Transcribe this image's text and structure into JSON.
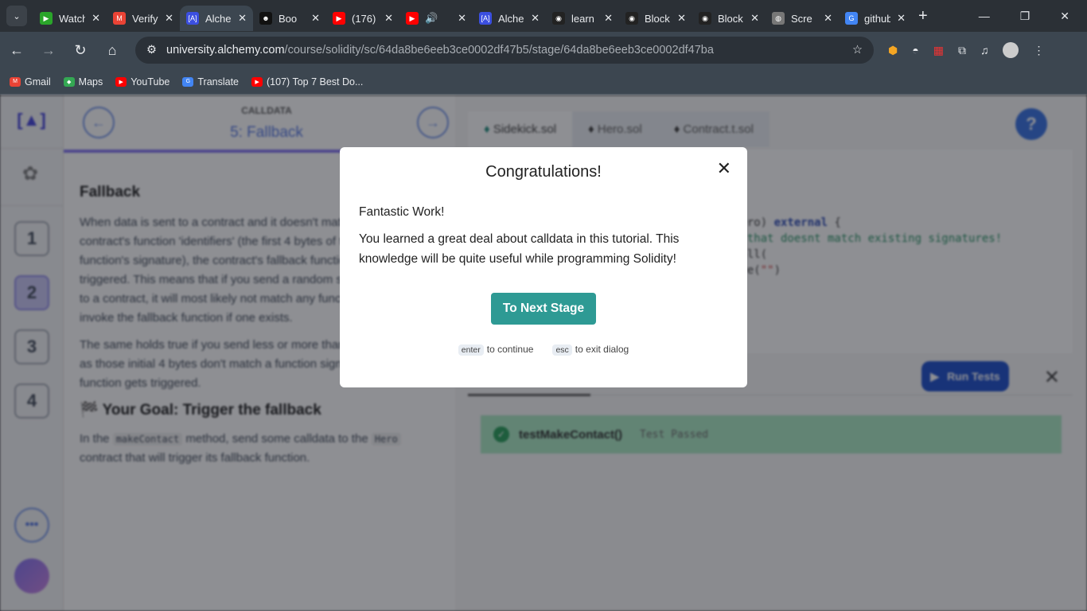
{
  "browser": {
    "tabs": [
      {
        "title": "Watch",
        "fav": "▶",
        "color": "#2aa52a"
      },
      {
        "title": "Verify",
        "fav": "M",
        "color": "#ea4335"
      },
      {
        "title": "Alchemy",
        "fav": "[A]",
        "color": "#3b4fe0",
        "active": true
      },
      {
        "title": "Boo",
        "fav": "☻",
        "color": "#111"
      },
      {
        "title": "(176)",
        "fav": "▶",
        "color": "#f00"
      },
      {
        "title": "🔊",
        "fav": "▶",
        "color": "#f00"
      },
      {
        "title": "Alchemy",
        "fav": "[A]",
        "color": "#3b4fe0"
      },
      {
        "title": "learn",
        "fav": "◉",
        "color": "#222"
      },
      {
        "title": "Block",
        "fav": "◉",
        "color": "#222"
      },
      {
        "title": "Block",
        "fav": "◉",
        "color": "#222"
      },
      {
        "title": "Scre",
        "fav": "◍",
        "color": "#777"
      },
      {
        "title": "github",
        "fav": "G",
        "color": "#4285f4"
      }
    ],
    "url_host": "university.alchemy.com",
    "url_path": "/course/solidity/sc/64da8be6eeb3ce0002df47b5/stage/64da8be6eeb3ce0002df47ba",
    "bookmarks": [
      {
        "label": "Gmail",
        "color": "#ea4335",
        "fav": "M"
      },
      {
        "label": "Maps",
        "color": "#34a853",
        "fav": "◆"
      },
      {
        "label": "YouTube",
        "color": "#f00",
        "fav": "▶"
      },
      {
        "label": "Translate",
        "color": "#4285f4",
        "fav": "G"
      },
      {
        "label": "(107) Top 7 Best Do...",
        "color": "#f00",
        "fav": "▶"
      }
    ]
  },
  "lesson": {
    "kicker": "CALLDATA",
    "stage_title": "5: Fallback",
    "stages": [
      "1",
      "2",
      "3",
      "4"
    ],
    "more": "•••",
    "heading": "Fallback",
    "para1": "When data is sent to a contract and it doesn't match any of the contract's function 'identifiers' (the first 4 bytes of the hash of the function's signature), the contract's fallback function will be triggered. This means that if you send a random sequence of bytes to a contract, it will most likely not match any function and will invoke the fallback function if one exists.",
    "para2": "The same holds true if you send less or more than 4 bytes. As long as those initial 4 bytes don't match a function signature, the fallback function gets triggered.",
    "goal": "🏁 Your Goal: Trigger the fallback",
    "goal_a": "In the ",
    "goal_code1": "makeContact",
    "goal_b": " method, send some calldata to the ",
    "goal_code2": "Hero",
    "goal_c": " contract that will trigger its fallback function."
  },
  "editor": {
    "files": [
      "Sidekick.sol",
      "Hero.sol",
      "Contract.t.sol"
    ],
    "help": "?",
    "code": {
      "l1a": "hero) ",
      "l1kw": "external",
      "l1b": " {",
      "l2": "a that doesnt match existing signatures!",
      "l3": "call(",
      "l4a": "ure(",
      "l4s": "\"\"",
      "l4b": ")"
    },
    "run_tests": "Run Tests",
    "test_name": "testMakeContact()",
    "test_status": "Test Passed"
  },
  "modal": {
    "title": "Congratulations!",
    "line1": "Fantastic Work!",
    "line2": "You learned a great deal about calldata in this tutorial. This knowledge will be quite useful while programming Solidity!",
    "button": "To Next Stage",
    "hint1_key": "enter",
    "hint1_text": "to continue",
    "hint2_key": "esc",
    "hint2_text": "to exit dialog"
  }
}
